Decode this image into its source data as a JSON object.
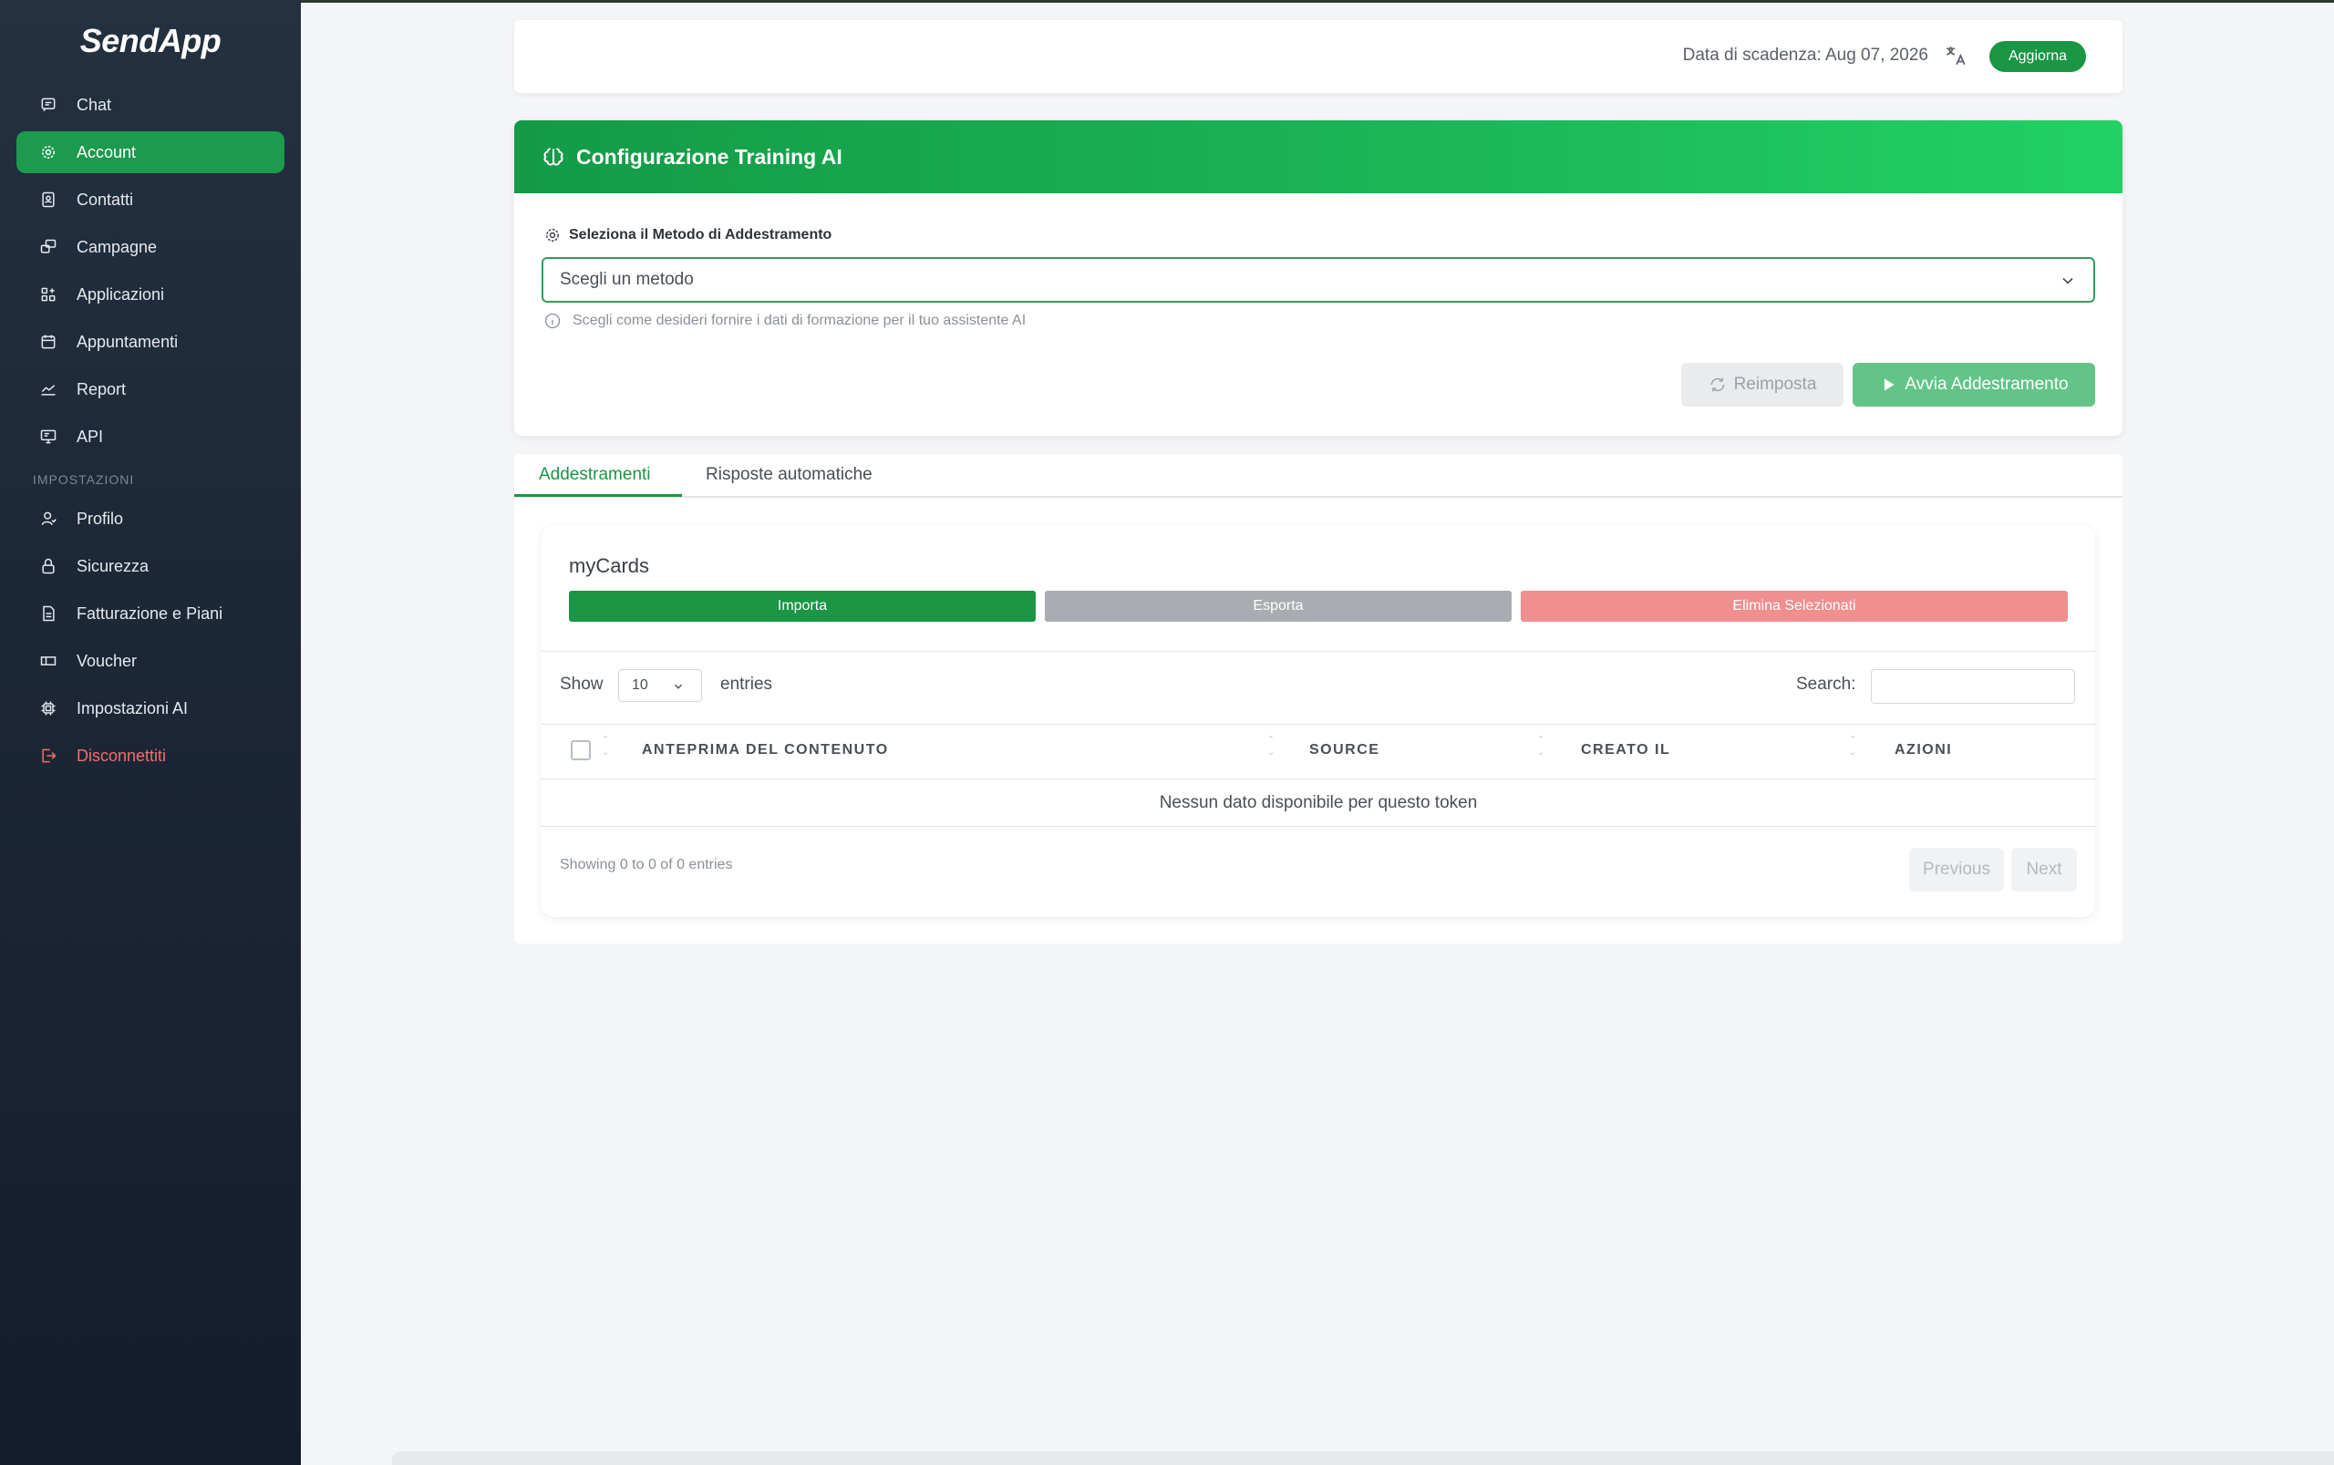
{
  "app": {
    "name": "SendApp"
  },
  "sidebar": {
    "items": [
      {
        "label": "Chat",
        "icon": "chat-icon"
      },
      {
        "label": "Account",
        "icon": "gear-icon",
        "active": true
      },
      {
        "label": "Contatti",
        "icon": "contacts-icon"
      },
      {
        "label": "Campagne",
        "icon": "campaign-icon"
      },
      {
        "label": "Applicazioni",
        "icon": "apps-icon"
      },
      {
        "label": "Appuntamenti",
        "icon": "calendar-icon"
      },
      {
        "label": "Report",
        "icon": "chart-icon"
      },
      {
        "label": "API",
        "icon": "monitor-icon"
      }
    ],
    "section_label": "IMPOSTAZIONI",
    "settings_items": [
      {
        "label": "Profilo",
        "icon": "user-icon"
      },
      {
        "label": "Sicurezza",
        "icon": "lock-icon"
      },
      {
        "label": "Fatturazione e Piani",
        "icon": "invoice-icon"
      },
      {
        "label": "Voucher",
        "icon": "ticket-icon"
      },
      {
        "label": "Impostazioni AI",
        "icon": "chip-icon"
      },
      {
        "label": "Disconnettiti",
        "icon": "logout-icon"
      }
    ]
  },
  "topbar": {
    "expiry_text": "Data di scadenza: Aug 07, 2026",
    "update_button": "Aggiorna"
  },
  "training": {
    "title": "Configurazione Training AI",
    "method_label": "Seleziona il Metodo di Addestramento",
    "method_select": "Scegli un metodo",
    "hint": "Scegli come desideri fornire i dati di formazione per il tuo assistente AI",
    "reset_button": "Reimposta",
    "start_button": "Avvia Addestramento"
  },
  "tabs": [
    {
      "label": "Addestramenti",
      "active": true
    },
    {
      "label": "Risposte automatiche"
    }
  ],
  "mycards": {
    "title": "myCards",
    "import_button": "Importa",
    "export_button": "Esporta",
    "delete_button": "Elimina Selezionati",
    "show_label": "Show",
    "entries_value": "10",
    "entries_label": "entries",
    "search_label": "Search:",
    "columns": [
      "ANTEPRIMA DEL CONTENUTO",
      "SOURCE",
      "CREATO IL",
      "AZIONI"
    ],
    "empty_text": "Nessun dato disponibile per questo token",
    "showing_text": "Showing 0 to 0 of 0 entries",
    "previous_button": "Previous",
    "next_button": "Next"
  },
  "colors": {
    "accent": "#1a9645",
    "sidebar_bg": "#1d2836",
    "danger": "#f0706b",
    "delete_button_bg": "#ef8f8f",
    "export_button_bg": "#a9acb1"
  }
}
